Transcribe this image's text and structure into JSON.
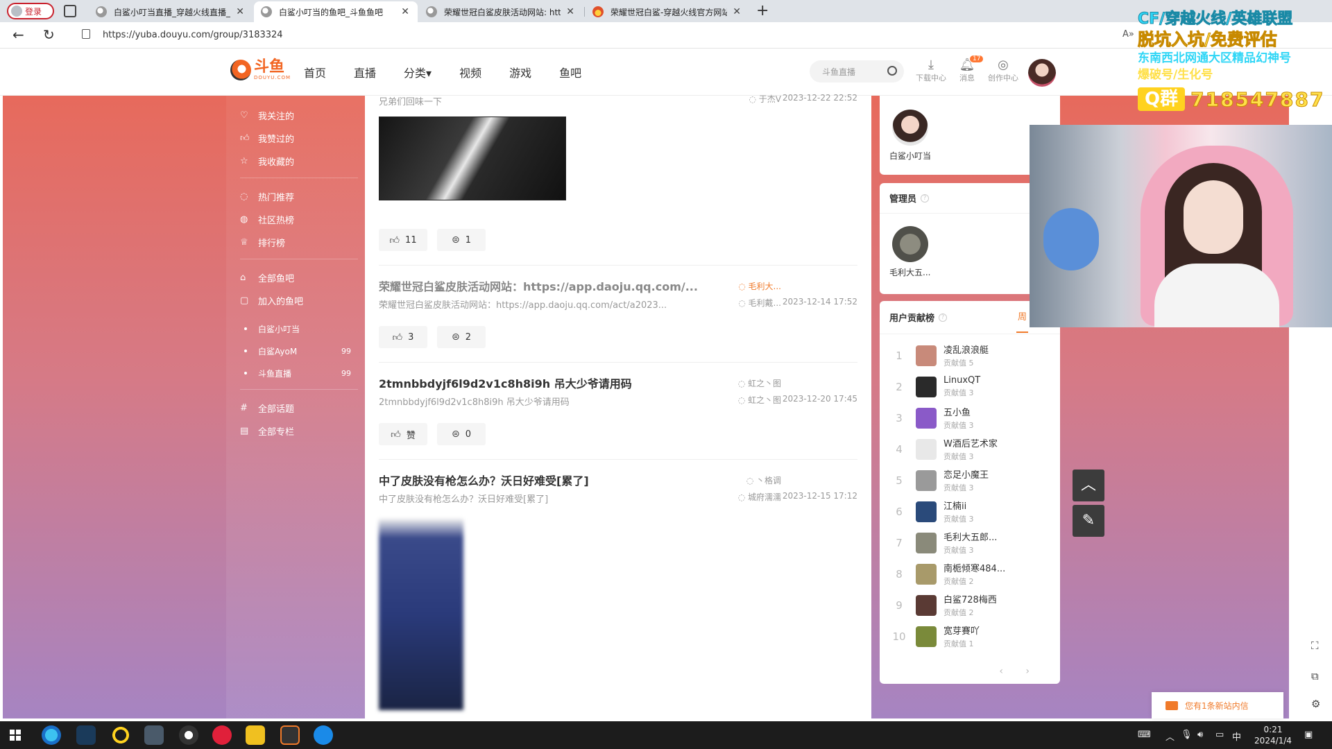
{
  "browser": {
    "login_label": "登录",
    "tabs": [
      {
        "title": "白鲨小叮当直播_穿越火线直播_斗",
        "active": false
      },
      {
        "title": "白鲨小叮当的鱼吧_斗鱼鱼吧",
        "active": true
      },
      {
        "title": "荣耀世冠白鲨皮肤活动网站: http",
        "active": false
      },
      {
        "title": "荣耀世冠白鲨-穿越火线官方网站",
        "active": false
      }
    ],
    "url": "https://yuba.douyu.com/group/3183324",
    "read_aloud": "A»"
  },
  "header": {
    "logo_text": "斗鱼",
    "logo_sub": "DOUYU.COM",
    "nav": [
      "首页",
      "直播",
      "分类▾",
      "视频",
      "游戏",
      "鱼吧"
    ],
    "search_placeholder": "斗鱼直播",
    "tools": [
      {
        "label": "下载中心",
        "icon": "download-icon"
      },
      {
        "label": "消息",
        "icon": "bell-icon",
        "badge": "17"
      },
      {
        "label": "创作中心",
        "icon": "bulb-icon"
      }
    ]
  },
  "left_nav": {
    "group1": [
      "我关注的",
      "我赞过的",
      "我收藏的"
    ],
    "group2": [
      "热门推荐",
      "社区热榜",
      "排行榜"
    ],
    "group3": [
      "全部鱼吧",
      "加入的鱼吧"
    ],
    "joined": [
      {
        "name": "白鲨小叮当",
        "count": ""
      },
      {
        "name": "白鲨AyoM",
        "count": "99"
      },
      {
        "name": "斗鱼直播",
        "count": "99"
      }
    ],
    "group4": [
      "全部话题",
      "全部专栏"
    ]
  },
  "feed": {
    "top_excerpt": "兄弟们回味一下",
    "top_author": "于杰V",
    "top_date": "2023-12-22 22:52",
    "top_likes": "11",
    "top_comments": "1",
    "posts": [
      {
        "title": "荣耀世冠白鲨皮肤活动网站：https://app.daoju.qq.com/...",
        "excerpt": "荣耀世冠白鲨皮肤活动网站：https://app.daoju.qq.com/act/a2023...",
        "author": "毛利大...",
        "replier": "毛利戴...",
        "date": "2023-12-14 17:52",
        "likes": "3",
        "comments": "2"
      },
      {
        "title": "2tmnbbdyjf6l9d2v1c8h8i9h 吊大少爷请用码",
        "excerpt": "2tmnbbdyjf6l9d2v1c8h8i9h 吊大少爷请用码",
        "author": "虹之丶图",
        "replier": "虹之丶图",
        "date": "2023-12-20 17:45",
        "likes": "赞",
        "comments": "0"
      },
      {
        "title": "中了皮肤没有枪怎么办？沃日好难受[累了]",
        "excerpt": "中了皮肤没有枪怎么办？沃日好难受[累了]",
        "author": "丶格调",
        "replier": "城府濡濡",
        "date": "2023-12-15 17:12"
      }
    ]
  },
  "sidebar": {
    "owner_name": "白鲨小叮当",
    "admin_title": "管理员",
    "admin_name": "毛利大五...",
    "rank_title": "用户贡献榜",
    "rank_tab": "周",
    "score_label": "贡献值",
    "ranks": [
      {
        "n": "1",
        "name": "凌乱浪浪艇",
        "score": "5",
        "color": "#c88a7a"
      },
      {
        "n": "2",
        "name": "LinuxQT",
        "score": "3",
        "color": "#2a2a2a"
      },
      {
        "n": "3",
        "name": "五小鱼",
        "score": "3",
        "color": "#8a5ac8"
      },
      {
        "n": "4",
        "name": "W酒后艺术家",
        "score": "3",
        "color": "#e8e8e8"
      },
      {
        "n": "5",
        "name": "恋足小魔王",
        "score": "3",
        "color": "#9a9a9a"
      },
      {
        "n": "6",
        "name": "江楠ii",
        "score": "3",
        "color": "#2a4a7a"
      },
      {
        "n": "7",
        "name": "毛利大五郎...",
        "score": "3",
        "color": "#8a8a7a"
      },
      {
        "n": "8",
        "name": "南栀倾寒484...",
        "score": "2",
        "color": "#a89a6a"
      },
      {
        "n": "9",
        "name": "白鲨728梅西",
        "score": "2",
        "color": "#5a3a34"
      },
      {
        "n": "10",
        "name": "宽芽賽吖",
        "score": "1",
        "color": "#7a8a3a"
      }
    ],
    "pager": "‹ ›"
  },
  "notice": "您有1条新站内信",
  "overlay": {
    "line1": "CF/穿越火线/英雄联盟",
    "line2": "脱坑入坑/免费评估",
    "line3": "东南西北网通大区精品幻神号",
    "line4": "爆破号/生化号",
    "qq_label": "Q群",
    "qq_number": "718547887"
  },
  "taskbar": {
    "time": "0:21",
    "date": "2024/1/4",
    "ime": "中"
  }
}
